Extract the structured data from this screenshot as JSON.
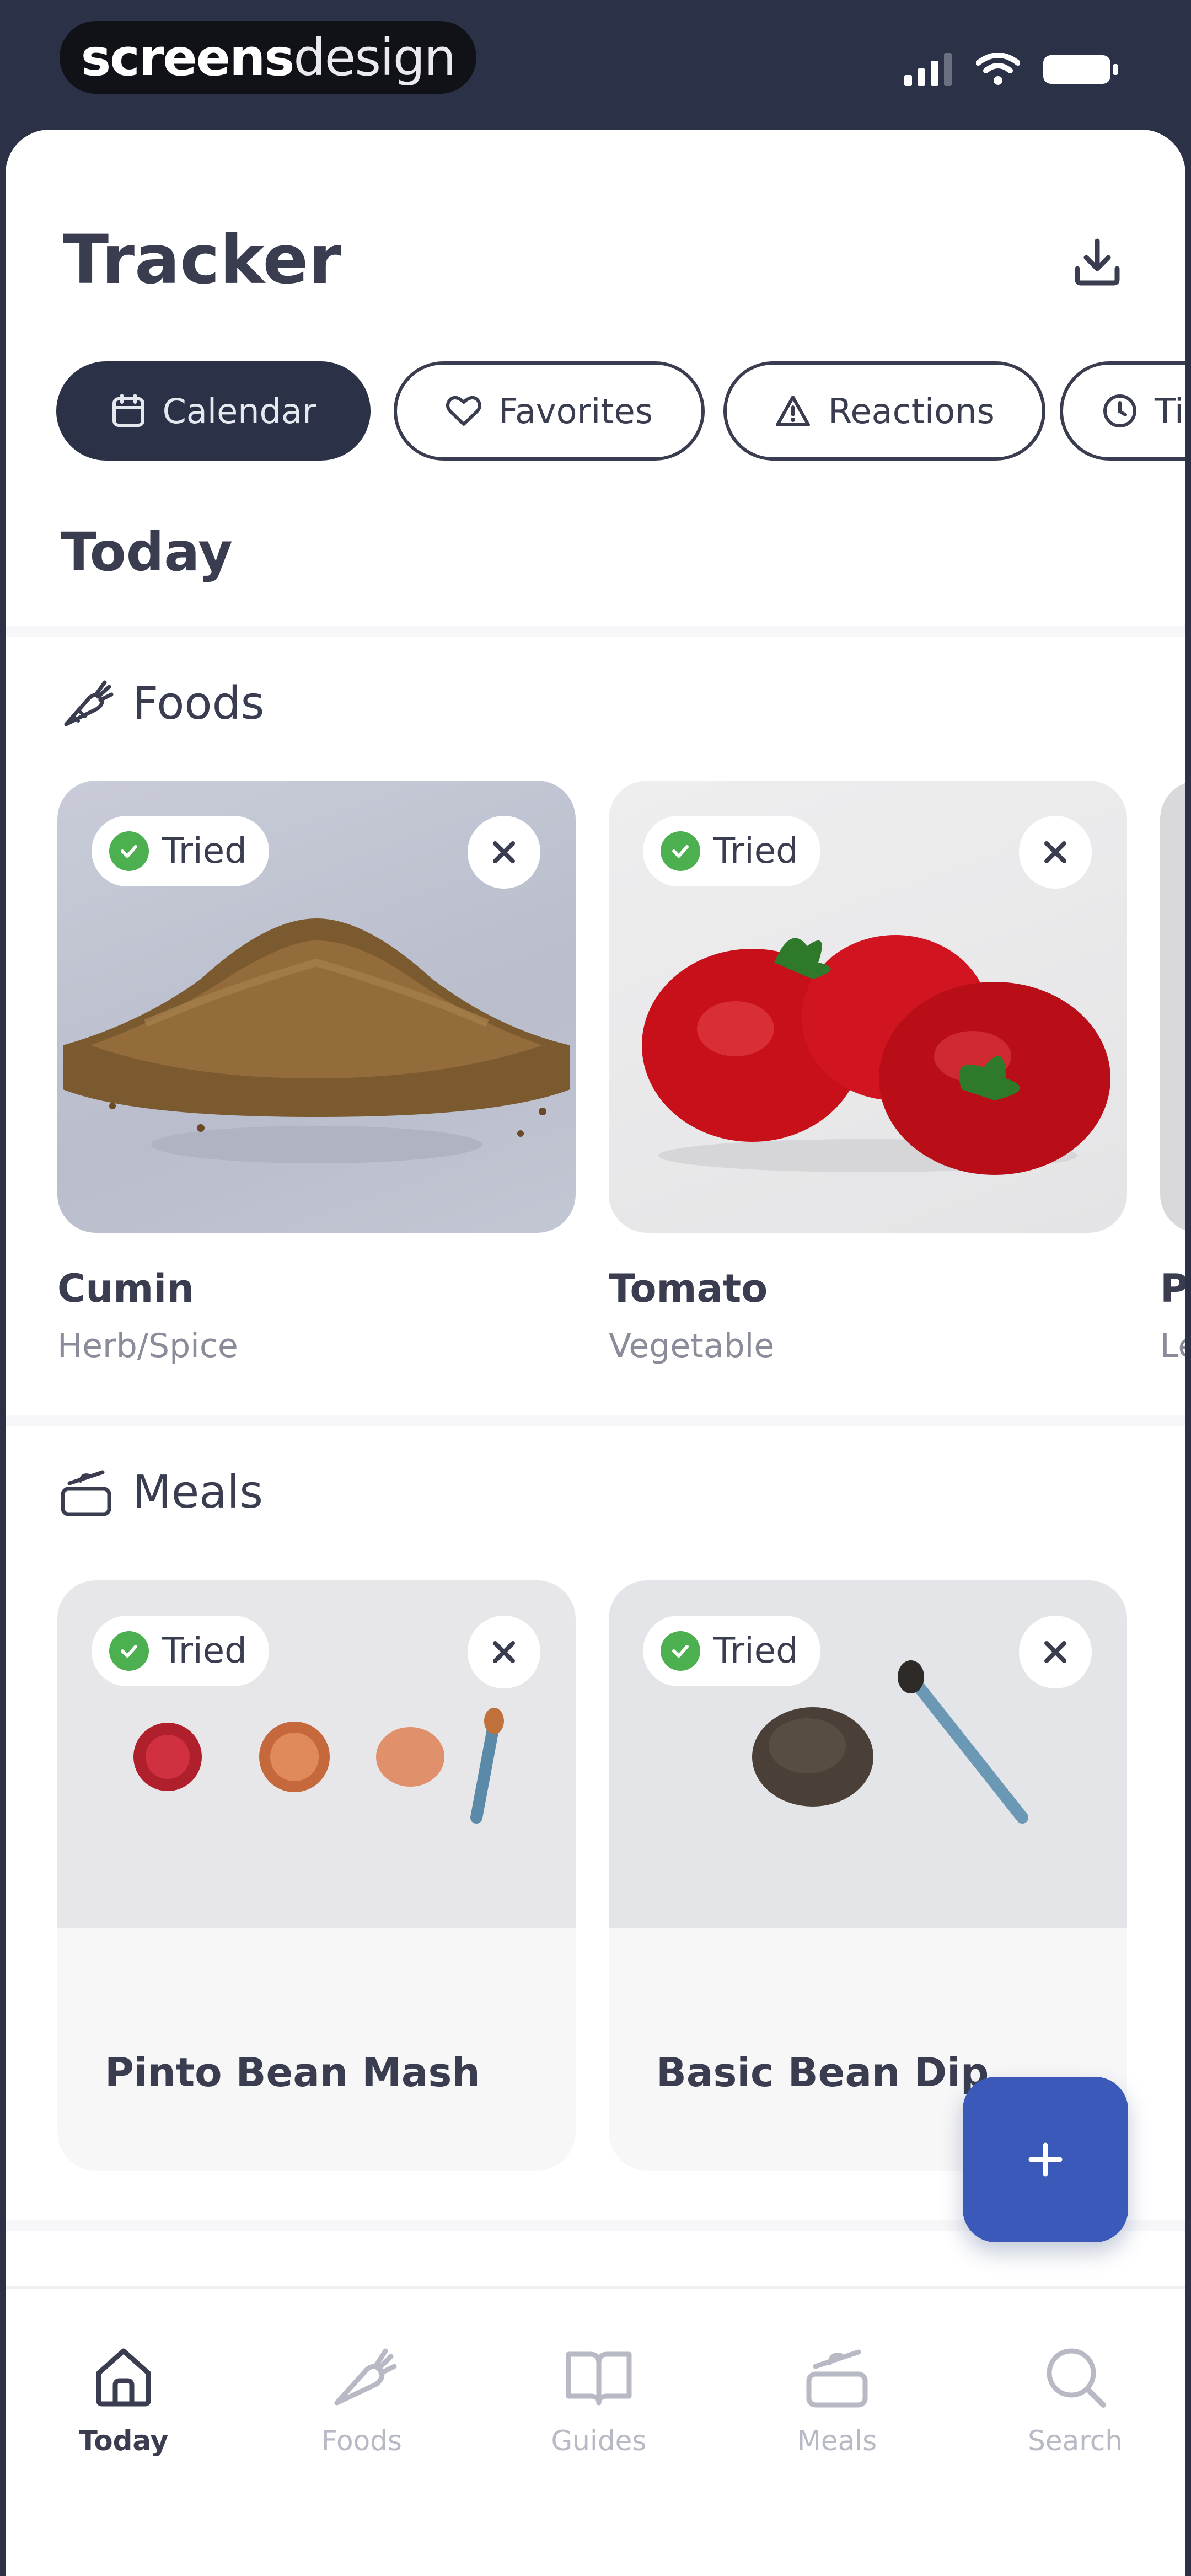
{
  "status_bar": {
    "brand_part1": "screens",
    "brand_part2": "design"
  },
  "header": {
    "title": "Tracker"
  },
  "tabs": [
    {
      "label": "Calendar",
      "icon": "calendar-icon",
      "active": true
    },
    {
      "label": "Favorites",
      "icon": "heart-icon",
      "active": false
    },
    {
      "label": "Reactions",
      "icon": "warning-icon",
      "active": false
    },
    {
      "label": "Ti",
      "icon": "clock-icon",
      "active": false
    }
  ],
  "section_date": "Today",
  "foods_section": {
    "heading": "Foods",
    "cards": [
      {
        "badge": "Tried",
        "title": "Cumin",
        "subtitle": "Herb/Spice"
      },
      {
        "badge": "Tried",
        "title": "Tomato",
        "subtitle": "Vegetable"
      },
      {
        "title": "Pl",
        "subtitle": "Le"
      }
    ]
  },
  "meals_section": {
    "heading": "Meals",
    "cards": [
      {
        "badge": "Tried",
        "title": "Pinto Bean Mash"
      },
      {
        "badge": "Tried",
        "title": "Basic Bean Dip"
      }
    ]
  },
  "fab": {
    "icon": "plus-icon"
  },
  "bottom_nav": [
    {
      "label": "Today",
      "icon": "home-icon",
      "active": true
    },
    {
      "label": "Foods",
      "icon": "carrot-icon",
      "active": false
    },
    {
      "label": "Guides",
      "icon": "book-icon",
      "active": false
    },
    {
      "label": "Meals",
      "icon": "pot-icon",
      "active": false
    },
    {
      "label": "Search",
      "icon": "search-icon",
      "active": false
    }
  ],
  "colors": {
    "navy": "#2b3147",
    "accent_blue": "#3b59b8",
    "tried_green": "#4caf50"
  }
}
